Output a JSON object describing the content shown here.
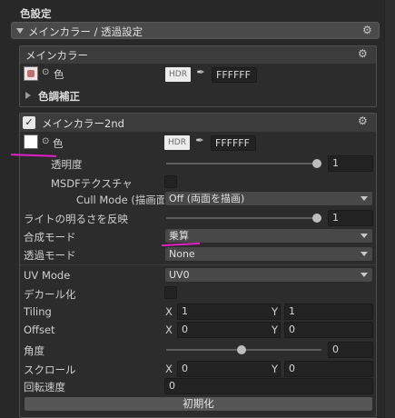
{
  "page": {
    "title": "色設定"
  },
  "main_section": {
    "label": "メインカラー / 透過設定"
  },
  "main_color_panel": {
    "header": "メインカラー",
    "color_label": "色",
    "hdr_label": "HDR",
    "hex_value": "FFFFFF",
    "tone_correction_label": "色調補正"
  },
  "main_color_2nd_panel": {
    "header": "メインカラー2nd",
    "enabled": true,
    "color_label": "色",
    "hdr_label": "HDR",
    "hex_value": "FFFFFF",
    "rows": {
      "opacity_label": "透明度",
      "opacity_value": "1",
      "opacity_slider_fraction": 1.0,
      "msdf_label": "MSDFテクスチャ",
      "cull_mode_label": "Cull Mode (描画面)",
      "cull_mode_value": "Off (両面を描画)",
      "light_label": "ライトの明るさを反映",
      "light_value": "1",
      "light_slider_fraction": 1.0,
      "blend_mode_label": "合成モード",
      "blend_mode_value": "乗算",
      "alpha_mode_label": "透過モード",
      "alpha_mode_value": "None",
      "uv_mode_label": "UV Mode",
      "uv_mode_value": "UV0",
      "decal_label": "デカール化",
      "tiling_label": "Tiling",
      "tiling_x": "1",
      "tiling_y": "1",
      "offset_label": "Offset",
      "offset_x": "0",
      "offset_y": "0",
      "angle_label": "角度",
      "angle_value": "0",
      "angle_slider_fraction": 0.5,
      "scroll_label": "スクロール",
      "scroll_x": "0",
      "scroll_y": "0",
      "rotation_speed_label": "回転速度",
      "rotation_speed_value": "0",
      "x_axis": "X",
      "y_axis": "Y",
      "reset_button": "初期化"
    }
  },
  "colors": {
    "annotation": "#e020c8",
    "background": "#282828",
    "field": "#222222"
  }
}
